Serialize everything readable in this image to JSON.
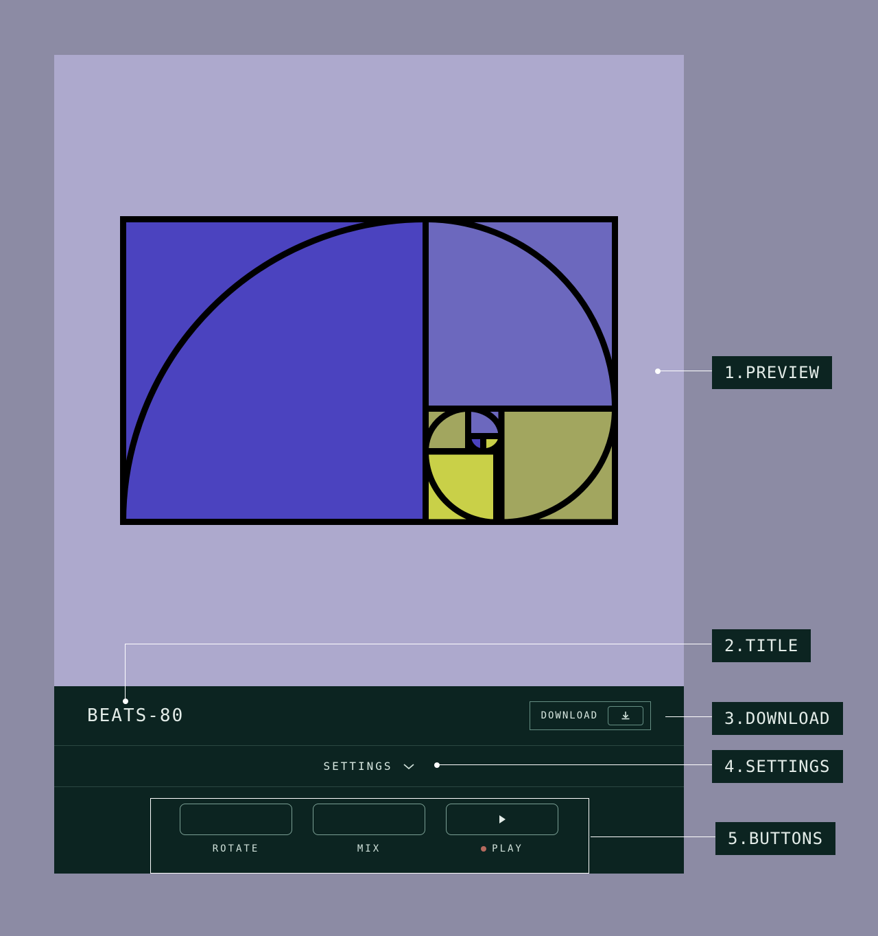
{
  "title": "BEATS-80",
  "download": {
    "label": "DOWNLOAD"
  },
  "settings": {
    "label": "SETTINGS"
  },
  "buttons": {
    "rotate": "ROTATE",
    "mix": "MIX",
    "play": "PLAY"
  },
  "annotations": {
    "preview": "1.PREVIEW",
    "title": "2.TITLE",
    "download": "3.DOWNLOAD",
    "settings": "4.SETTINGS",
    "buttons": "5.BUTTONS"
  },
  "artwork": {
    "colors": {
      "blue_a": "#4b43bf",
      "blue_b": "#6c68be",
      "olive_a": "#a2a65f",
      "olive_b": "#c9d048",
      "stroke": "#000000"
    }
  }
}
